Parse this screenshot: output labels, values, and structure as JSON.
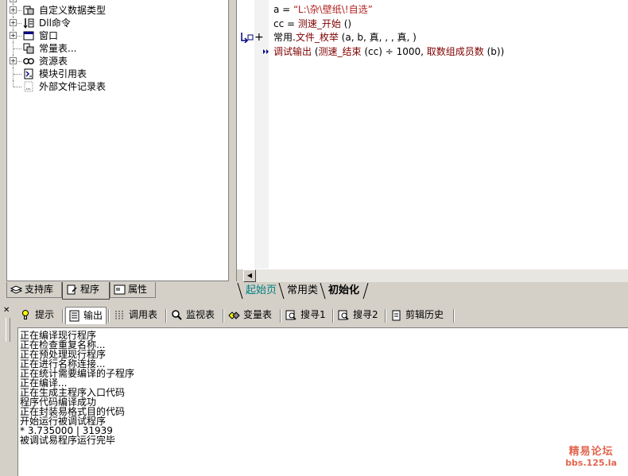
{
  "tree": {
    "items": [
      {
        "label": "自定义数据类型",
        "icon": "data-type-icon"
      },
      {
        "label": "Dll命令",
        "icon": "dll-icon"
      },
      {
        "label": "窗口",
        "icon": "window-icon"
      },
      {
        "label": "常量表...",
        "icon": "constant-icon"
      },
      {
        "label": "资源表",
        "icon": "resource-icon"
      },
      {
        "label": "模块引用表",
        "icon": "module-icon"
      },
      {
        "label": "外部文件记录表",
        "icon": "file-icon"
      }
    ]
  },
  "left_tabs": {
    "support": "支持库",
    "program": "程序",
    "property": "属性"
  },
  "code": {
    "line1": {
      "var": "a",
      "eq": " = ",
      "str": "“L:\\杂\\壁纸\\!自选”"
    },
    "line2": {
      "var": "cc",
      "eq": " = ",
      "fn": "测速_开始",
      "args": " ()"
    },
    "line3": {
      "prefix": "常用.",
      "fn": "文件_枚举",
      "args": " (a, b, 真, , , 真, )"
    },
    "line4": {
      "fn": "调试输出",
      "args1": " (",
      "fn2": "测速_结束",
      "args2": " (cc) ÷ 1000, ",
      "fn3": "取数组成员数",
      "args3": " (b))"
    },
    "margin_plus": "+"
  },
  "editor_tabs": {
    "start": "起始页",
    "common": "常用类",
    "init": "初始化"
  },
  "tool_tabs": {
    "hint": "提示",
    "output": "输出",
    "call_table": "调用表",
    "watch": "监视表",
    "vars": "变量表",
    "search1": "搜寻1",
    "search2": "搜寻2",
    "clip_history": "剪辑历史"
  },
  "output_lines": [
    "正在编译现行程序",
    "正在检查重复名称...",
    "正在预处理现行程序",
    "正在进行名称连接...",
    "正在统计需要编译的子程序",
    "正在编译...",
    "正在生成主程序入口代码",
    "程序代码编译成功",
    "正在封装易格式目的代码",
    "开始运行被调试程序",
    "* 3.735000 | 31939",
    "被调试易程序运行完毕"
  ],
  "watermark": {
    "line1": "精易论坛",
    "line2": "bbs.125.la"
  },
  "colors": {
    "string": "#b22222",
    "function": "#800000",
    "watermark": "#e2664e",
    "active_tab_text": "#008080"
  }
}
